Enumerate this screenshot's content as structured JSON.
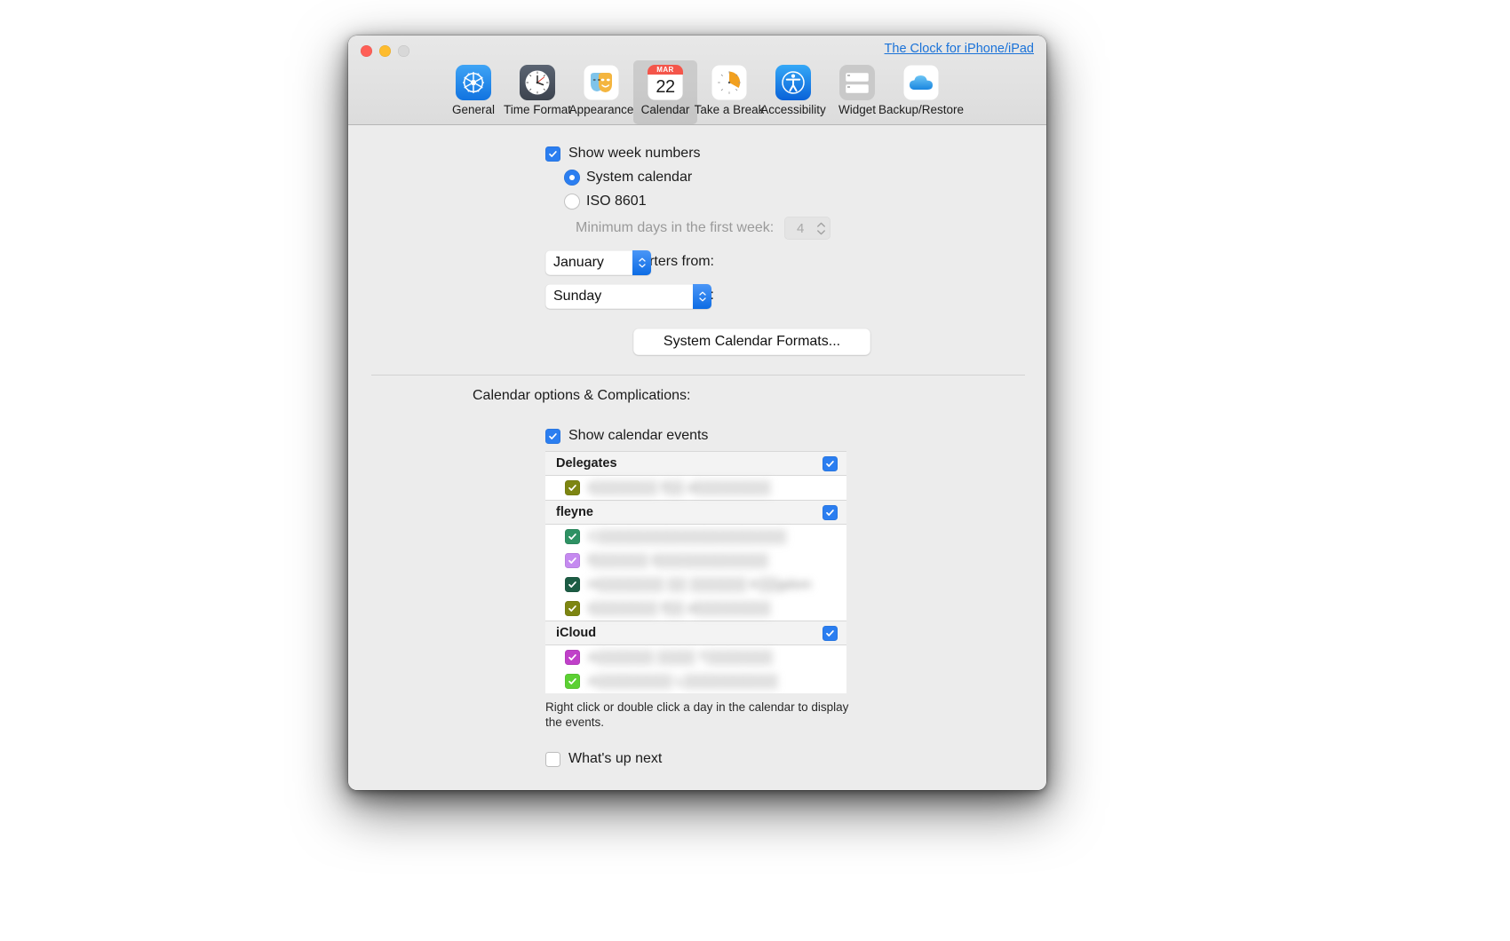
{
  "window": {
    "header_link": "The Clock for iPhone/iPad",
    "traffic_lights": [
      "close",
      "minimize",
      "zoom"
    ]
  },
  "toolbar": {
    "items": [
      {
        "id": "general",
        "label": "General",
        "icon": "gear-icon",
        "selected": false
      },
      {
        "id": "time-format",
        "label": "Time Format",
        "icon": "clock-icon",
        "selected": false
      },
      {
        "id": "appearance",
        "label": "Appearance",
        "icon": "theater-masks-icon",
        "selected": false
      },
      {
        "id": "calendar",
        "label": "Calendar",
        "icon": "calendar-icon",
        "selected": true
      },
      {
        "id": "take-a-break",
        "label": "Take a Break",
        "icon": "timer-icon",
        "selected": false
      },
      {
        "id": "accessibility",
        "label": "Accessibility",
        "icon": "accessibility-icon",
        "selected": false
      },
      {
        "id": "widget",
        "label": "Widget",
        "icon": "widget-icon",
        "selected": false
      },
      {
        "id": "backup-restore",
        "label": "Backup/Restore",
        "icon": "cloud-icon",
        "selected": false
      }
    ],
    "calendar_icon": {
      "month": "MAR",
      "day": "22"
    }
  },
  "week_numbers": {
    "show_label": "Show week numbers",
    "show_checked": true,
    "options": [
      {
        "id": "system-calendar",
        "label": "System calendar",
        "selected": true
      },
      {
        "id": "iso-8601",
        "label": "ISO 8601",
        "selected": false
      }
    ],
    "minimum_days_label": "Minimum days in the first week:",
    "minimum_days_value": "4",
    "minimum_days_enabled": false
  },
  "quarters": {
    "label": "Start quarters from:",
    "value": "January"
  },
  "start_week": {
    "label": "Start week on:",
    "value": "Sunday"
  },
  "formats_button": {
    "label": "System Calendar Formats..."
  },
  "calendar_options": {
    "section_title": "Calendar options & Complications:",
    "show_events_label": "Show calendar events",
    "show_events_checked": true,
    "groups": [
      {
        "name": "Delegates",
        "checked": true,
        "calendars": [
          {
            "name": "t▒▒▒▒▒▒▒ f▒▒ d▒▒▒▒▒▒▒▒",
            "color": "#7d8512",
            "checked": true,
            "redacted": true
          }
        ]
      },
      {
        "name": "fleyne",
        "checked": true,
        "calendars": [
          {
            "name": "C▒▒▒▒▒▒▒▒▒▒▒▒▒▒▒▒▒▒▒▒",
            "color": "#2e9163",
            "checked": true,
            "redacted": true
          },
          {
            "name": "f▒▒▒▒▒▒ l▒▒▒▒▒▒▒▒▒▒▒▒",
            "color": "#c58af0",
            "checked": true,
            "redacted": true
          },
          {
            "name": "H▒▒▒▒▒▒▒ ▒▒ ▒▒▒▒▒▒ K▒▒gdom",
            "color": "#1c5c44",
            "checked": true,
            "redacted": true
          },
          {
            "name": "t▒▒▒▒▒▒▒ f▒▒ d▒▒▒▒▒▒▒▒",
            "color": "#7d8512",
            "checked": true,
            "redacted": true
          }
        ]
      },
      {
        "name": "iCloud",
        "checked": true,
        "calendars": [
          {
            "name": "A▒▒▒▒▒▒ ▒▒▒▒ T▒▒▒▒▒▒▒",
            "color": "#c040c9",
            "checked": true,
            "redacted": true
          },
          {
            "name": "A▒▒▒▒▒▒▒▒ L▒▒▒▒▒▒▒▒▒▒",
            "color": "#5cd033",
            "checked": true,
            "redacted": true
          }
        ]
      }
    ],
    "hint": "Right click or double click a day in the calendar to display the events.",
    "whats_up_next_label": "What's up next",
    "whats_up_next_checked": false
  },
  "colors": {
    "accent": "#2b7ef0",
    "link": "#1a72d8",
    "window_bg": "#ececec",
    "toolbar_selected": "rgba(0,0,0,0.10)"
  }
}
